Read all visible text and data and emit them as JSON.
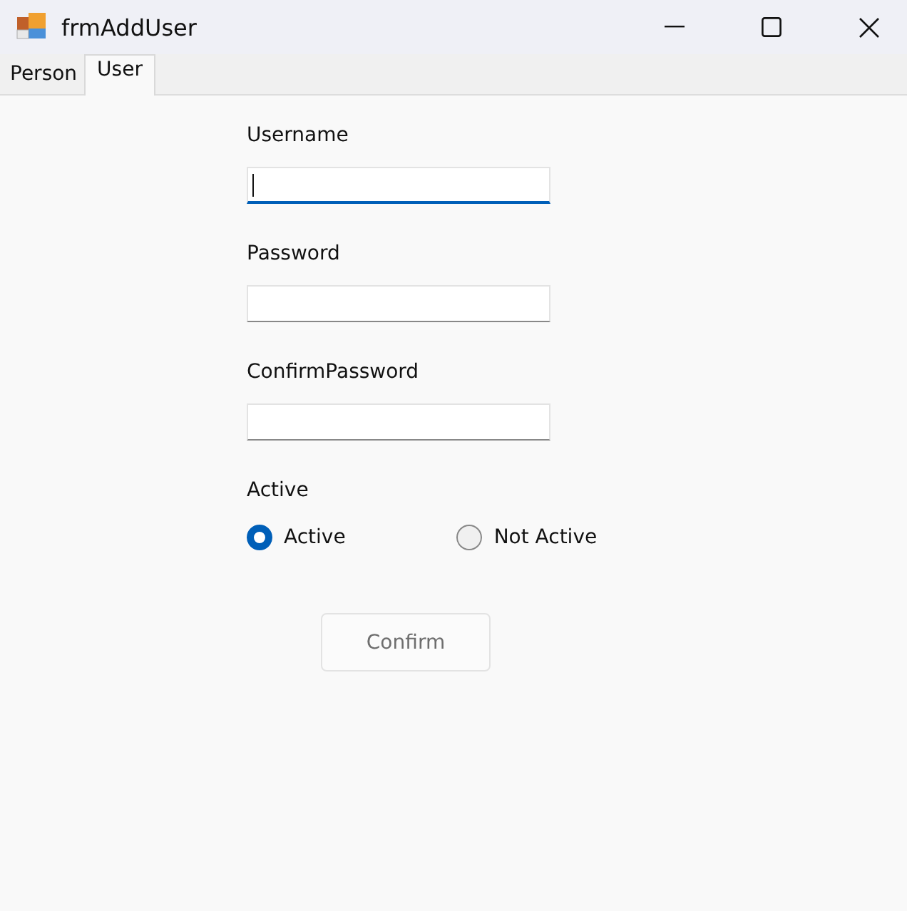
{
  "window": {
    "title": "frmAddUser"
  },
  "tabs": [
    {
      "label": "Person",
      "selected": false
    },
    {
      "label": "User",
      "selected": true
    }
  ],
  "fields": [
    {
      "label": "Username",
      "focused": true
    },
    {
      "label": "Password",
      "focused": false
    },
    {
      "label": "ConfirmPassword",
      "focused": false
    }
  ],
  "active_group": {
    "label": "Active",
    "options": [
      {
        "label": "Active",
        "selected": true
      },
      {
        "label": "Not Active",
        "selected": false
      }
    ]
  },
  "confirm_button": {
    "label": "Confirm",
    "disabled": true
  }
}
